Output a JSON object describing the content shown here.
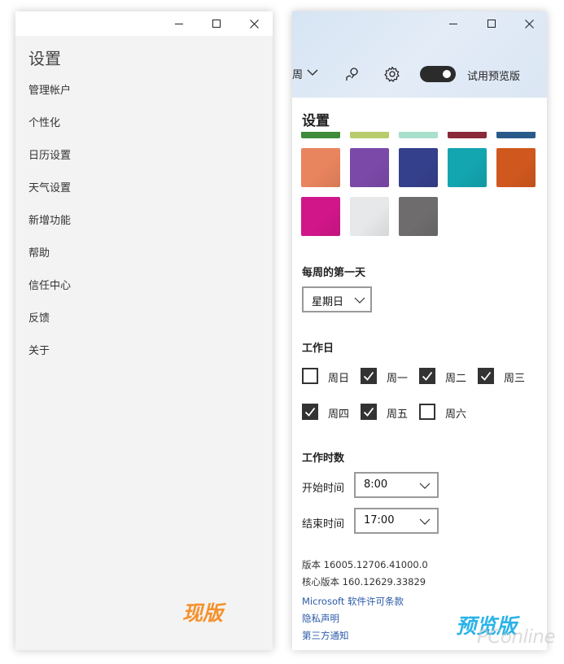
{
  "left_window": {
    "title": "设置",
    "nav": [
      "管理帐户",
      "个性化",
      "日历设置",
      "天气设置",
      "新增功能",
      "帮助",
      "信任中心",
      "反馈",
      "关于"
    ],
    "badge": "现版"
  },
  "right_window": {
    "toolbar": {
      "view_label": "周",
      "preview_label": "试用预览版",
      "toggle_on": true
    },
    "title": "设置",
    "colors": {
      "partial_row": [
        "#3d8b3b",
        "#b8cc6e",
        "#a8e0cc",
        "#8a2a3a",
        "#2a5a8a"
      ],
      "row1": [
        "#e8845e",
        "#7b4aa8",
        "#34408c",
        "#13a5b0",
        "#d0581e"
      ],
      "row2": [
        "#d1168a",
        "#e6e8ea",
        "#6e6c6c"
      ]
    },
    "first_day": {
      "heading": "每周的第一天",
      "selected": "星期日"
    },
    "workdays": {
      "heading": "工作日",
      "days": [
        {
          "label": "周日",
          "checked": false
        },
        {
          "label": "周一",
          "checked": true
        },
        {
          "label": "周二",
          "checked": true
        },
        {
          "label": "周三",
          "checked": true
        },
        {
          "label": "周四",
          "checked": true
        },
        {
          "label": "周五",
          "checked": true
        },
        {
          "label": "周六",
          "checked": false
        }
      ]
    },
    "work_hours": {
      "heading": "工作时数",
      "start_label": "开始时间",
      "start_value": "8:00",
      "end_label": "结束时间",
      "end_value": "17:00"
    },
    "footer": {
      "version": "版本 16005.12706.41000.0",
      "core_version": "核心版本 160.12629.33829",
      "license_link": "Microsoft 软件许可条款",
      "privacy_link": "隐私声明",
      "third_party_link": "第三方通知"
    },
    "badge": "预览版"
  },
  "watermark": "PConline"
}
